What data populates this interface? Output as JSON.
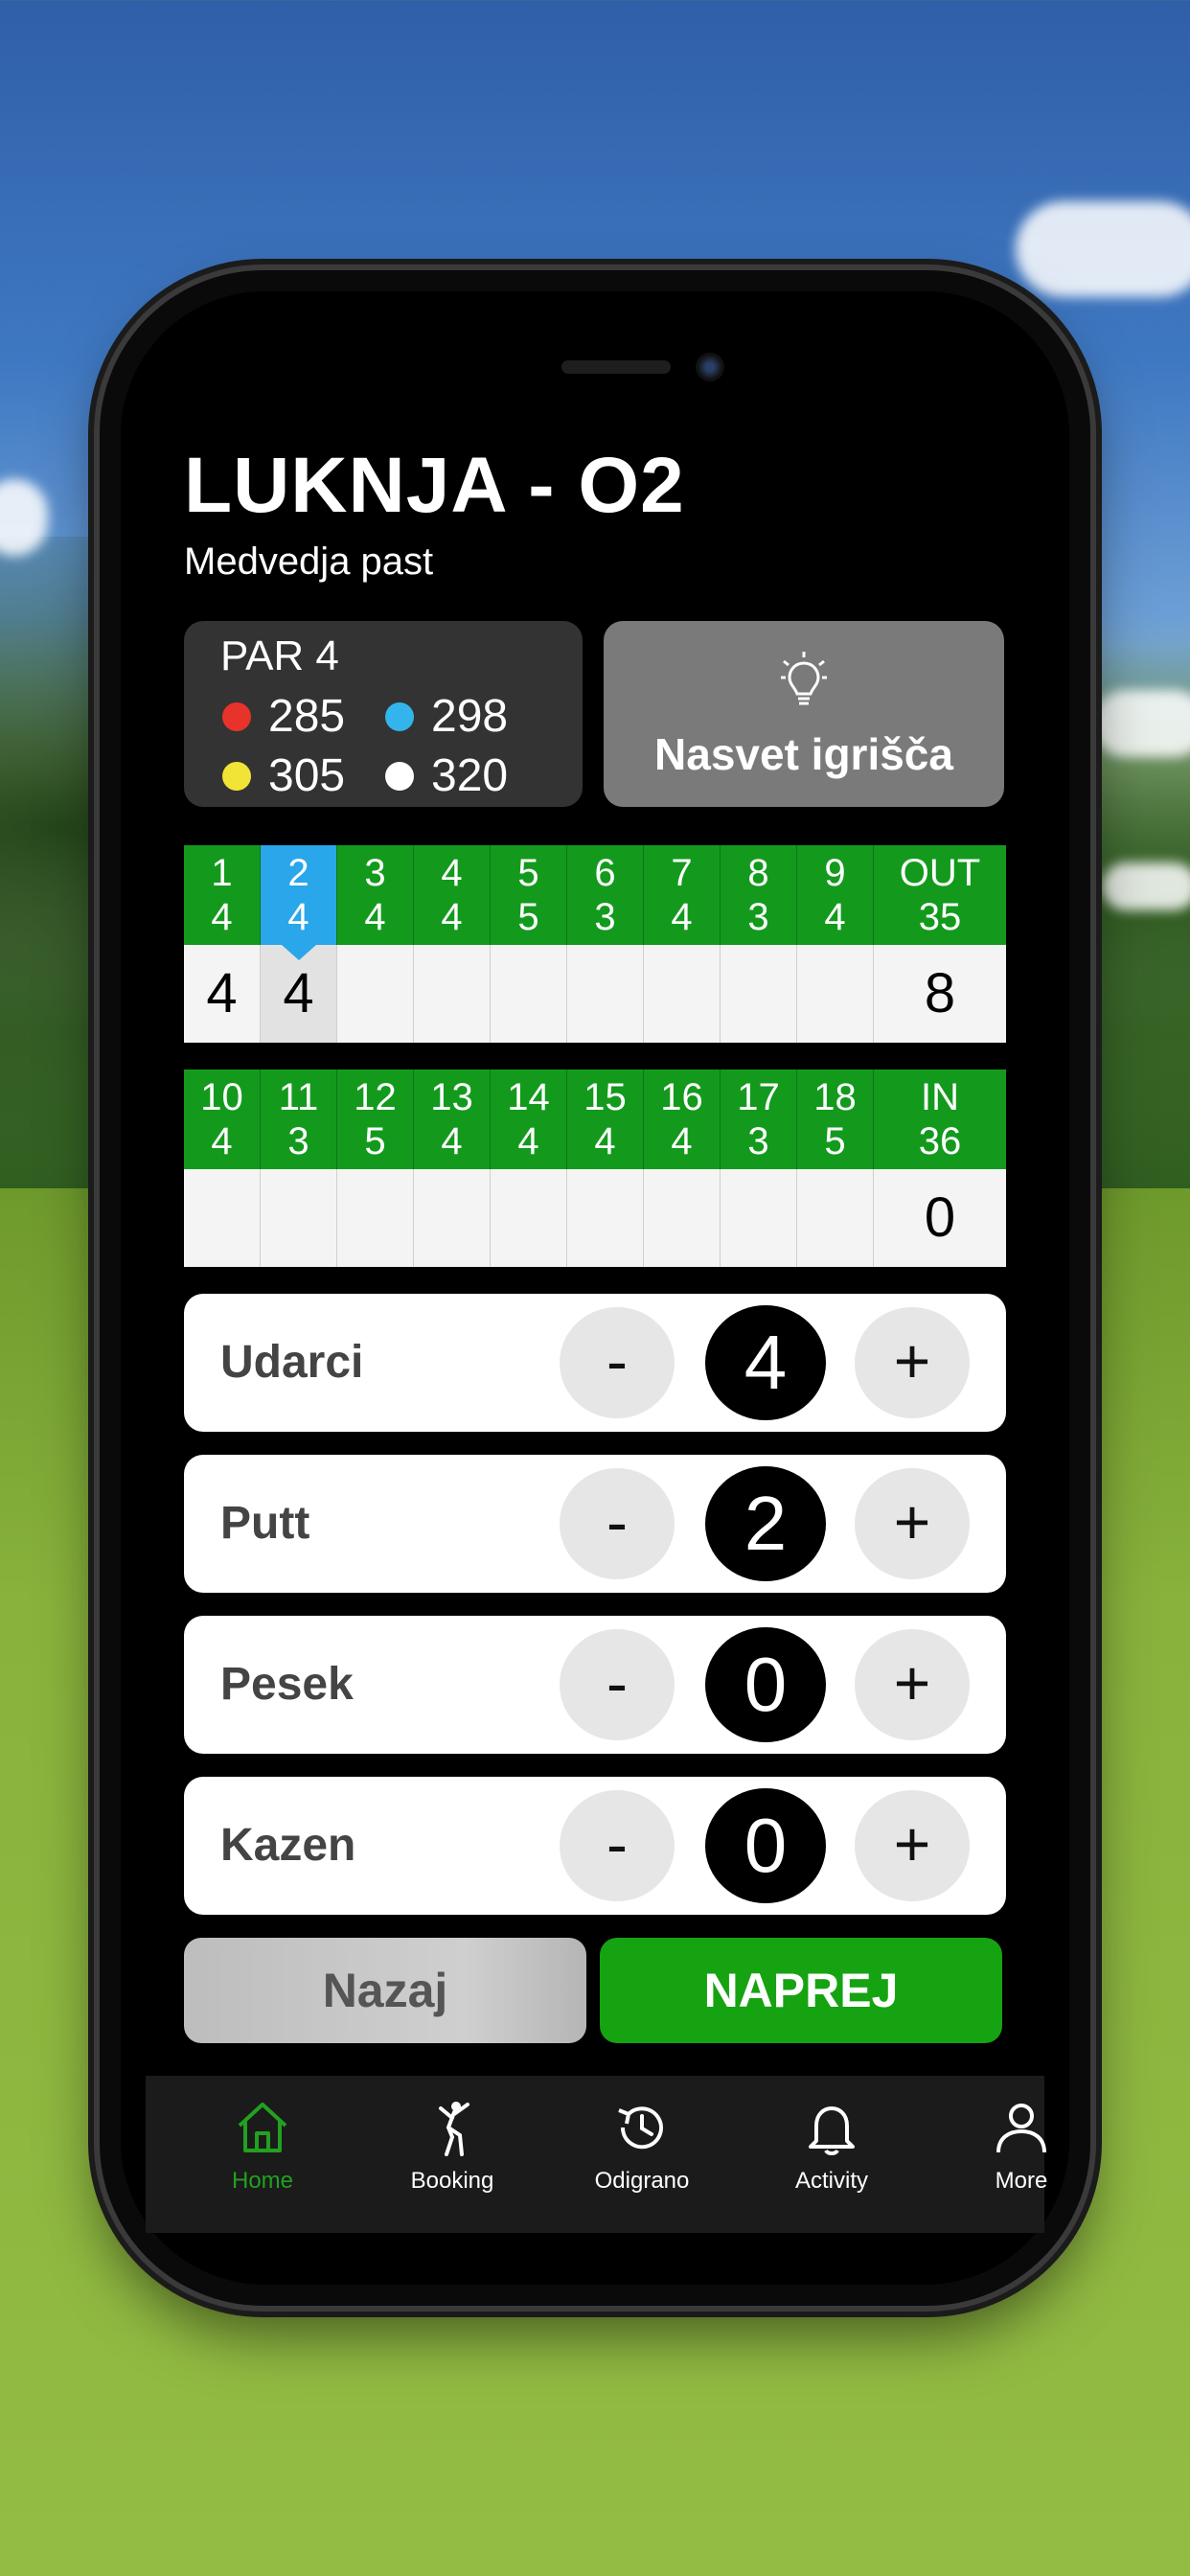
{
  "header": {
    "title": "LUKNJA - O2",
    "subtitle": "Medvedja past"
  },
  "par_card": {
    "par_label": "PAR 4",
    "tees": [
      {
        "color": "#e8332a",
        "value": "285"
      },
      {
        "color": "#34b4ec",
        "value": "298"
      },
      {
        "color": "#f2e436",
        "value": "305"
      },
      {
        "color": "#ffffff",
        "value": "320"
      }
    ]
  },
  "tip_button": {
    "label": "Nasvet igrišča",
    "icon": "lightbulb-icon"
  },
  "front_nine": {
    "holes": [
      {
        "hole": "1",
        "par": "4",
        "score": "4"
      },
      {
        "hole": "2",
        "par": "4",
        "score": "4"
      },
      {
        "hole": "3",
        "par": "4",
        "score": ""
      },
      {
        "hole": "4",
        "par": "4",
        "score": ""
      },
      {
        "hole": "5",
        "par": "5",
        "score": ""
      },
      {
        "hole": "6",
        "par": "3",
        "score": ""
      },
      {
        "hole": "7",
        "par": "4",
        "score": ""
      },
      {
        "hole": "8",
        "par": "3",
        "score": ""
      },
      {
        "hole": "9",
        "par": "4",
        "score": ""
      }
    ],
    "total_label": "OUT",
    "total_par": "35",
    "total_score": "8"
  },
  "back_nine": {
    "holes": [
      {
        "hole": "10",
        "par": "4",
        "score": ""
      },
      {
        "hole": "11",
        "par": "3",
        "score": ""
      },
      {
        "hole": "12",
        "par": "5",
        "score": ""
      },
      {
        "hole": "13",
        "par": "4",
        "score": ""
      },
      {
        "hole": "14",
        "par": "4",
        "score": ""
      },
      {
        "hole": "15",
        "par": "4",
        "score": ""
      },
      {
        "hole": "16",
        "par": "4",
        "score": ""
      },
      {
        "hole": "17",
        "par": "3",
        "score": ""
      },
      {
        "hole": "18",
        "par": "5",
        "score": ""
      }
    ],
    "total_label": "IN",
    "total_par": "36",
    "total_score": "0"
  },
  "stats": [
    {
      "label": "Udarci",
      "value": "4",
      "minus": "-",
      "plus": "+"
    },
    {
      "label": "Putt",
      "value": "2",
      "minus": "-",
      "plus": "+"
    },
    {
      "label": "Pesek",
      "value": "0",
      "minus": "-",
      "plus": "+"
    },
    {
      "label": "Kazen",
      "value": "0",
      "minus": "-",
      "plus": "+"
    }
  ],
  "nav_buttons": {
    "back": "Nazaj",
    "next": "NAPREJ"
  },
  "tabbar": {
    "items": [
      {
        "label": "Home",
        "icon": "home-icon",
        "active": true
      },
      {
        "label": "Booking",
        "icon": "golfer-icon",
        "active": false
      },
      {
        "label": "Odigrano",
        "icon": "history-icon",
        "active": false
      },
      {
        "label": "Activity",
        "icon": "bell-icon",
        "active": false
      },
      {
        "label": "More",
        "icon": "person-icon",
        "active": false
      }
    ]
  },
  "colors": {
    "accent_green": "#16a312",
    "header_green": "#139a1d",
    "active_blue": "#2aa6ea"
  }
}
